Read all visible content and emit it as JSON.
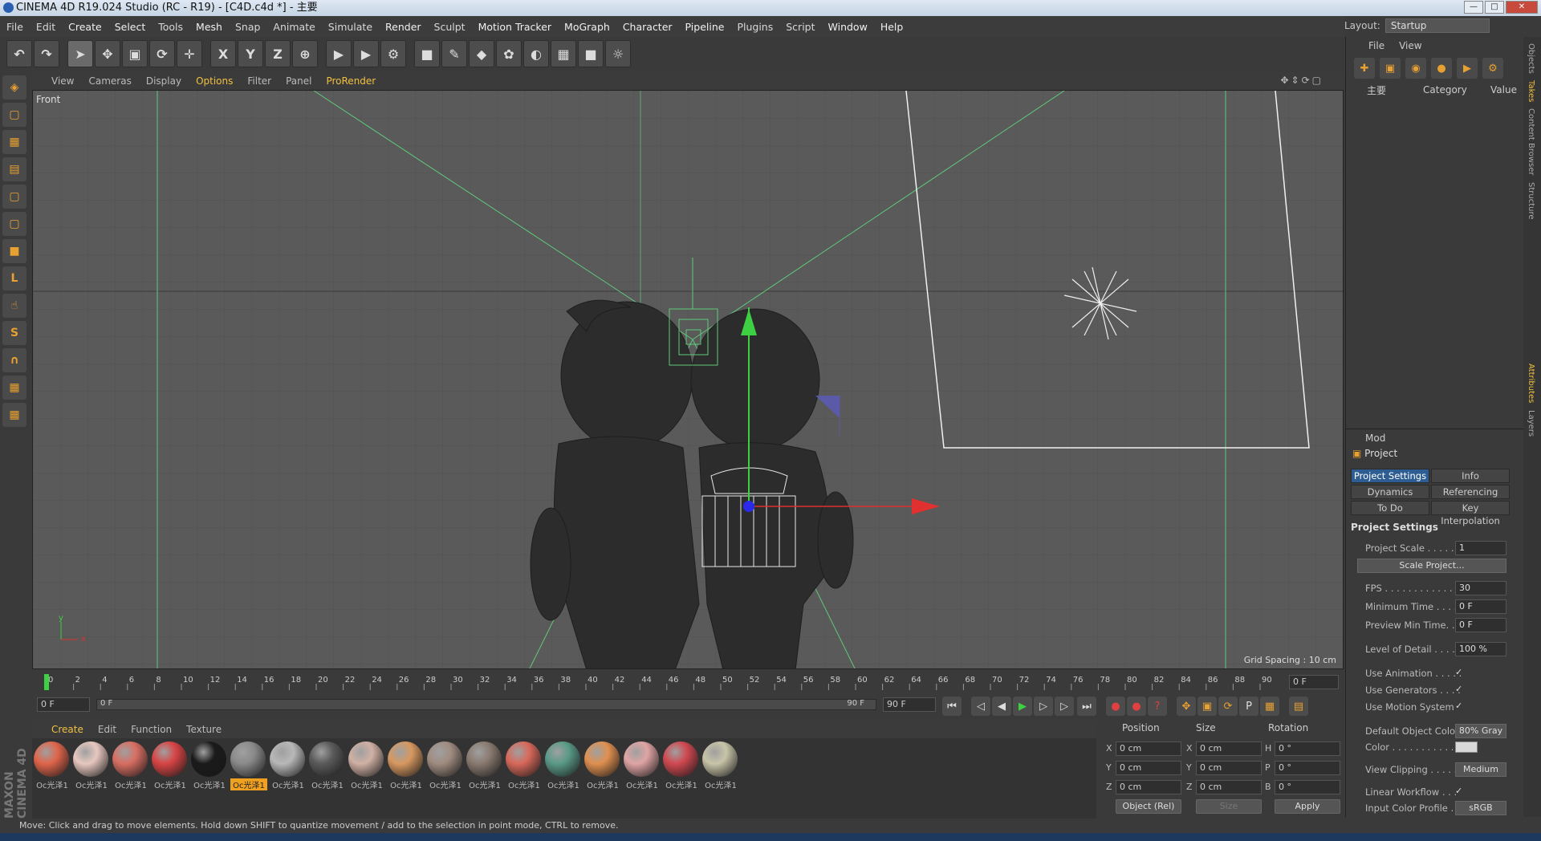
{
  "app": {
    "title": "CINEMA 4D R19.024 Studio (RC - R19) - [C4D.c4d *] - 主要"
  },
  "menu": [
    "File",
    "Edit",
    "Create",
    "Select",
    "Tools",
    "Mesh",
    "Snap",
    "Animate",
    "Simulate",
    "Render",
    "Sculpt",
    "Motion Tracker",
    "MoGraph",
    "Character",
    "Pipeline",
    "Plugins",
    "Script",
    "Window",
    "Help"
  ],
  "layout": {
    "label": "Layout:",
    "value": "Startup"
  },
  "toolbar": {
    "axis_x": "X",
    "axis_y": "Y",
    "axis_z": "Z"
  },
  "viewport": {
    "menu": [
      "View",
      "Cameras",
      "Display",
      "Options",
      "Filter",
      "Panel",
      "ProRender"
    ],
    "name": "Front",
    "grid_spacing": "Grid Spacing : 10 cm",
    "axis_y": "y",
    "axis_x": "x"
  },
  "timeline": {
    "ticks": [
      "0",
      "2",
      "4",
      "6",
      "8",
      "10",
      "12",
      "14",
      "16",
      "18",
      "20",
      "22",
      "24",
      "26",
      "28",
      "30",
      "32",
      "34",
      "36",
      "38",
      "40",
      "42",
      "44",
      "46",
      "48",
      "50",
      "52",
      "54",
      "56",
      "58",
      "60",
      "62",
      "64",
      "66",
      "68",
      "70",
      "72",
      "74",
      "76",
      "78",
      "80",
      "82",
      "84",
      "86",
      "88",
      "90"
    ],
    "current_frame": "0 F",
    "start": "0 F",
    "range_start": "0 F",
    "range_end": "90 F",
    "end": "90 F"
  },
  "material_manager": {
    "menu": [
      "Create",
      "Edit",
      "Function",
      "Texture"
    ],
    "materials": [
      {
        "label": "Oc光泽1",
        "color": "#e0654a"
      },
      {
        "label": "Oc光泽1",
        "color": "#e8c8c0"
      },
      {
        "label": "Oc光泽1",
        "color": "#d86e62"
      },
      {
        "label": "Oc光泽1",
        "color": "#d84444"
      },
      {
        "label": "Oc光泽1",
        "color": "#1a1a1a"
      },
      {
        "label": "Oc光泽1",
        "color": "#8a8a8a"
      },
      {
        "label": "Oc光泽1",
        "color": "#b8b8b8"
      },
      {
        "label": "Oc光泽1",
        "color": "#5a5a5a"
      },
      {
        "label": "Oc光泽1",
        "color": "#d0b0a4"
      },
      {
        "label": "Oc光泽1",
        "color": "#d89860"
      },
      {
        "label": "Oc光泽1",
        "color": "#a08c80"
      },
      {
        "label": "Oc光泽1",
        "color": "#8a7a70"
      },
      {
        "label": "Oc光泽1",
        "color": "#d8685a"
      },
      {
        "label": "Oc光泽1",
        "color": "#5a9a88"
      },
      {
        "label": "Oc光泽1",
        "color": "#e09050"
      },
      {
        "label": "Oc光泽1",
        "color": "#e0a4a4"
      },
      {
        "label": "Oc光泽1",
        "color": "#d04850"
      },
      {
        "label": "Oc光泽1",
        "color": "#c8c4a8"
      }
    ],
    "selected_index": 5
  },
  "coordinates": {
    "headers": {
      "position": "Position",
      "size": "Size",
      "rotation": "Rotation"
    },
    "rows": [
      {
        "a": "X",
        "pos": "0 cm",
        "b": "X",
        "size": "0 cm",
        "c": "H",
        "rot": "0 °"
      },
      {
        "a": "Y",
        "pos": "0 cm",
        "b": "Y",
        "size": "0 cm",
        "c": "P",
        "rot": "0 °"
      },
      {
        "a": "Z",
        "pos": "0 cm",
        "b": "Z",
        "size": "0 cm",
        "c": "B",
        "rot": "0 °"
      }
    ],
    "mode": "Object (Rel)",
    "size_mode": "Size",
    "apply": "Apply"
  },
  "status": "Move: Click and drag to move elements. Hold down SHIFT to quantize movement / add to the selection in point mode, CTRL to remove.",
  "branding": "MAXON CINEMA 4D",
  "right_panel": {
    "menu": [
      "File",
      "View"
    ],
    "objects_header": {
      "name": "主要",
      "category": "Category",
      "value": "Value"
    },
    "attr_menu": "Mod",
    "title": "Project",
    "tabs": [
      {
        "label": "Project Settings",
        "active": true
      },
      {
        "label": "Info",
        "active": false
      },
      {
        "label": "Dynamics",
        "active": false
      },
      {
        "label": "Referencing",
        "active": false
      },
      {
        "label": "To Do",
        "active": false
      },
      {
        "label": "Key Interpolation",
        "active": false
      }
    ],
    "section": "Project Settings",
    "props": {
      "scale_label": "Project Scale . . . . . .",
      "scale_value": "1",
      "scale_button": "Scale Project...",
      "fps_label": "FPS . . . . . . . . . . . . .",
      "fps_value": "30",
      "min_label": "Minimum Time . . . .",
      "min_value": "0 F",
      "prev_label": "Preview Min Time. . .",
      "prev_value": "0 F",
      "lod_label": "Level of Detail . . . . .",
      "lod_value": "100 %",
      "anim_label": "Use Animation . . . . .",
      "gen_label": "Use Generators . . . .",
      "motion_label": "Use Motion System",
      "check": "✓",
      "doc_label": "Default Object Color",
      "doc_value": "80% Gray",
      "color_label": "Color . . . . . . . . . . .",
      "clip_label": "View Clipping . . . . .",
      "clip_value": "Medium",
      "lw_label": "Linear Workflow . . .",
      "icp_label": "Input Color Profile . .",
      "icp_value": "sRGB"
    }
  },
  "side_tabs": [
    "Objects",
    "Takes",
    "Content Browser",
    "Structure",
    "Attributes",
    "Layers"
  ]
}
